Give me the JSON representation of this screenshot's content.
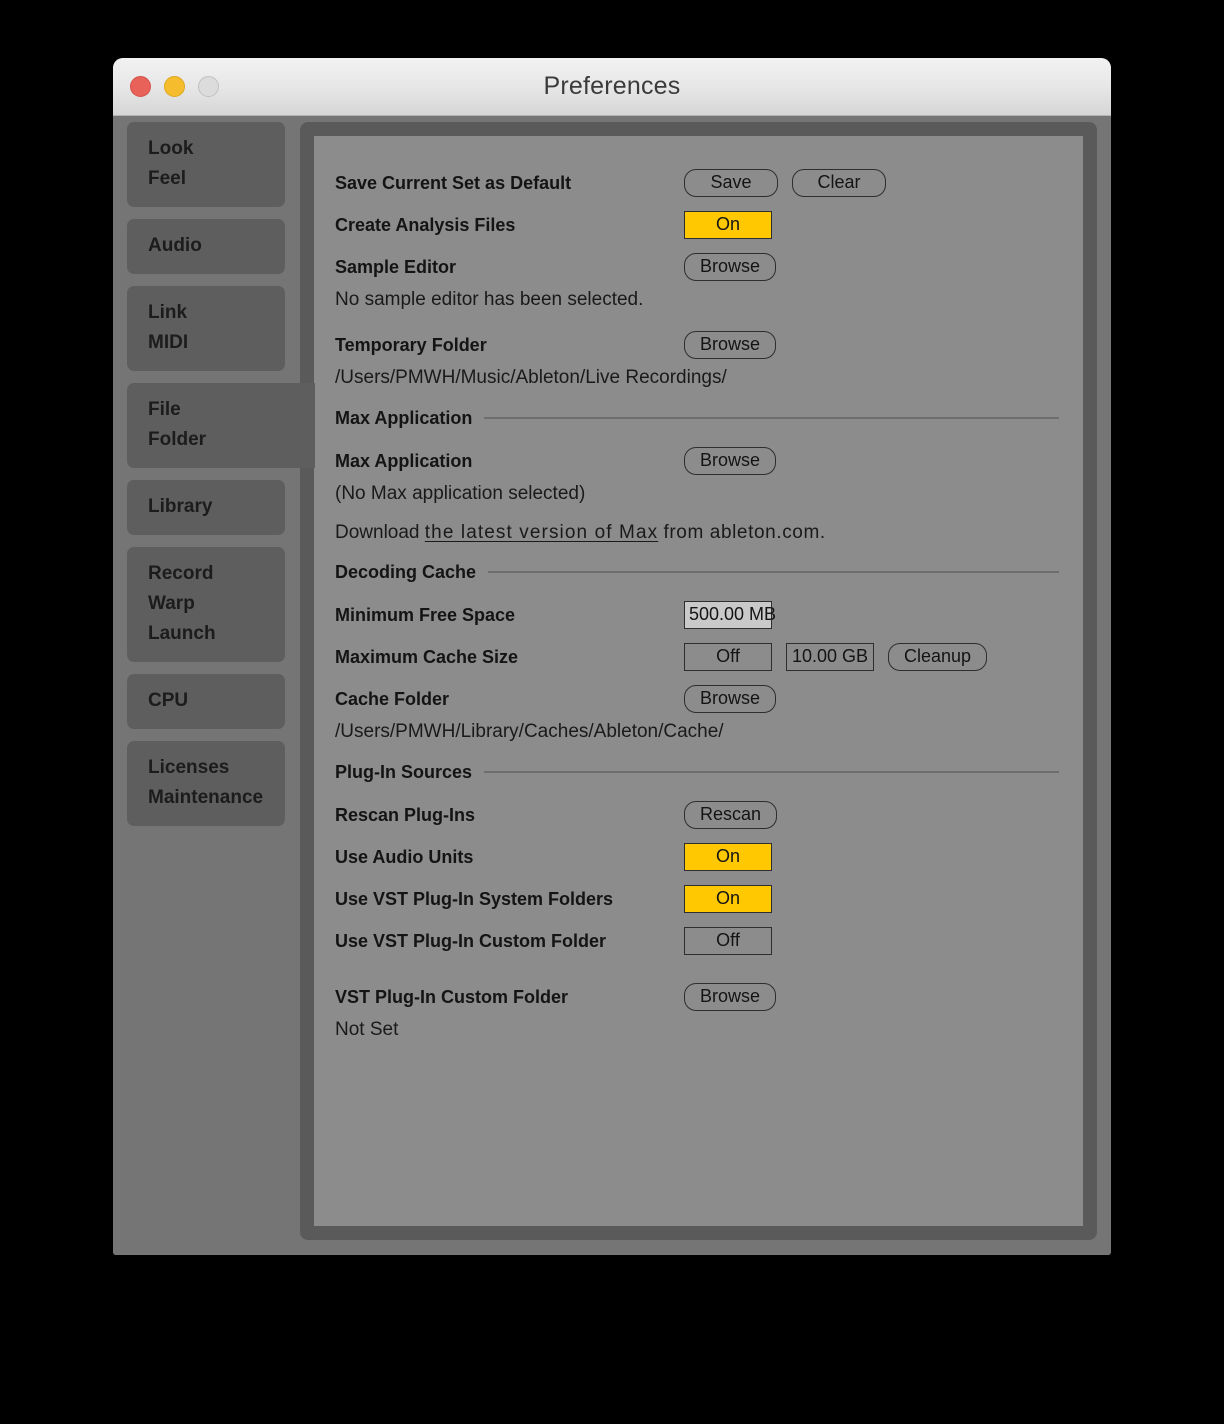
{
  "window": {
    "title": "Preferences",
    "traffic_lights": [
      {
        "name": "close-button",
        "color": "#e8625a"
      },
      {
        "name": "minimize-button",
        "color": "#f5bc2e"
      },
      {
        "name": "zoom-button",
        "color": "#dcdcdc"
      }
    ]
  },
  "sidebar": {
    "items": [
      {
        "lines": [
          "Look",
          "Feel"
        ],
        "selected": false
      },
      {
        "lines": [
          "Audio"
        ],
        "selected": false
      },
      {
        "lines": [
          "Link",
          "MIDI"
        ],
        "selected": false
      },
      {
        "lines": [
          "File",
          "Folder"
        ],
        "selected": true
      },
      {
        "lines": [
          "Library"
        ],
        "selected": false
      },
      {
        "lines": [
          "Record",
          "Warp",
          "Launch"
        ],
        "selected": false
      },
      {
        "lines": [
          "CPU"
        ],
        "selected": false
      },
      {
        "lines": [
          "Licenses",
          "Maintenance"
        ],
        "selected": false
      }
    ]
  },
  "main": {
    "save_default": {
      "label": "Save Current Set as Default",
      "save_button": "Save",
      "clear_button": "Clear"
    },
    "create_analysis": {
      "label": "Create Analysis Files",
      "value": "On"
    },
    "sample_editor": {
      "label": "Sample Editor",
      "browse_button": "Browse",
      "info": "No sample editor has been selected."
    },
    "temporary_folder": {
      "label": "Temporary Folder",
      "browse_button": "Browse",
      "path": "/Users/PMWH/Music/Ableton/Live Recordings/"
    },
    "max_application_section": {
      "title": "Max Application",
      "label": "Max Application",
      "browse_button": "Browse",
      "info": "(No Max application selected)",
      "download_prefix": "Download",
      "download_link": "the latest version of Max",
      "download_suffix": "from  ableton.com."
    },
    "decoding_cache_section": {
      "title": "Decoding Cache",
      "minimum_free_space": {
        "label": "Minimum Free Space",
        "value": "500.00 MB"
      },
      "maximum_cache_size": {
        "label": "Maximum Cache Size",
        "toggle": "Off",
        "size": "10.00 GB",
        "cleanup_button": "Cleanup"
      },
      "cache_folder": {
        "label": "Cache Folder",
        "browse_button": "Browse",
        "path": "/Users/PMWH/Library/Caches/Ableton/Cache/"
      }
    },
    "plugin_sources_section": {
      "title": "Plug-In Sources",
      "rescan": {
        "label": "Rescan Plug-Ins",
        "button": "Rescan"
      },
      "use_audio_units": {
        "label": "Use Audio Units",
        "value": "On"
      },
      "use_vst_system": {
        "label": "Use VST Plug-In System Folders",
        "value": "On"
      },
      "use_vst_custom": {
        "label": "Use VST Plug-In Custom Folder",
        "value": "Off"
      },
      "vst_custom_folder": {
        "label": "VST Plug-In Custom Folder",
        "browse_button": "Browse",
        "path": "Not Set"
      }
    }
  },
  "colors": {
    "accent_on": "#ffc800",
    "panel": "#8c8c8c",
    "window": "#757575",
    "frame": "#5a5a5a",
    "sidebar_item": "#5e5e5e"
  }
}
